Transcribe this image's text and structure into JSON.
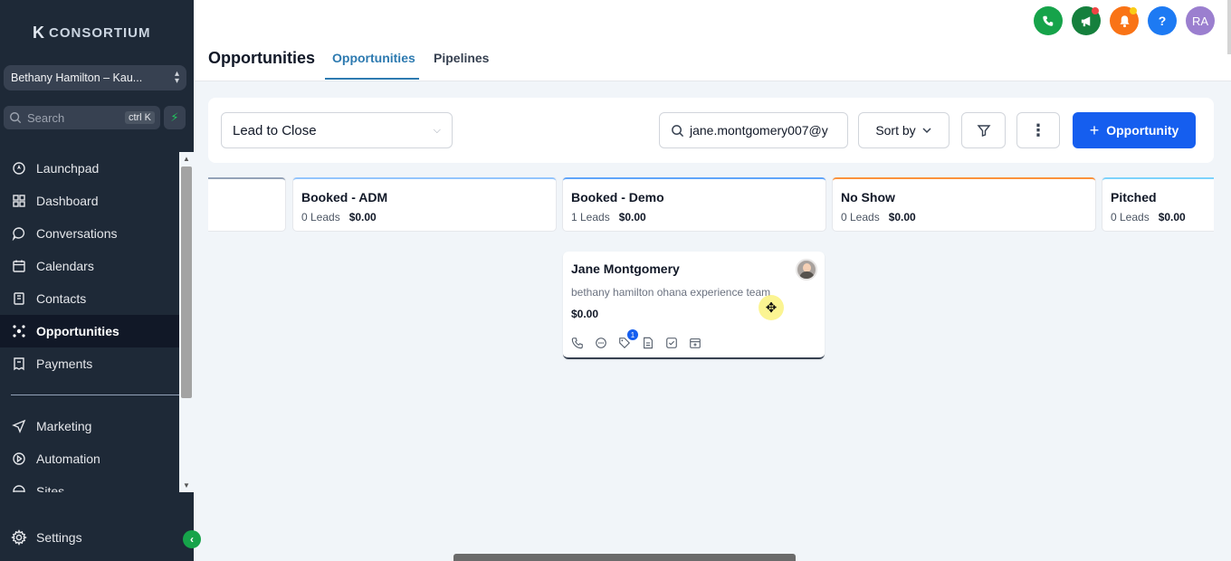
{
  "sidebar": {
    "logo": "CONSORTIUM",
    "account": "Bethany Hamilton – Kau...",
    "search_placeholder": "Search",
    "search_shortcut": "ctrl K",
    "items": [
      {
        "label": "Launchpad",
        "icon": "rocket-icon"
      },
      {
        "label": "Dashboard",
        "icon": "grid-icon"
      },
      {
        "label": "Conversations",
        "icon": "chat-icon"
      },
      {
        "label": "Calendars",
        "icon": "calendar-icon"
      },
      {
        "label": "Contacts",
        "icon": "contacts-icon"
      },
      {
        "label": "Opportunities",
        "icon": "opportunities-icon",
        "active": true
      },
      {
        "label": "Payments",
        "icon": "receipt-icon"
      },
      {
        "label": "Marketing",
        "icon": "send-icon"
      },
      {
        "label": "Automation",
        "icon": "automation-icon"
      },
      {
        "label": "Sites",
        "icon": "globe-icon"
      }
    ],
    "settings": "Settings"
  },
  "header": {
    "title": "Opportunities",
    "tabs": [
      {
        "label": "Opportunities",
        "active": true
      },
      {
        "label": "Pipelines",
        "active": false
      }
    ],
    "avatar_initials": "RA",
    "colors": {
      "phone": "#16a34a",
      "announce": "#15803d",
      "bell": "#f97316",
      "help": "#1d7af3",
      "avatar": "#9b7fcf"
    }
  },
  "toolbar": {
    "pipeline": "Lead to Close",
    "search_value": "jane.montgomery007@y",
    "sort_label": "Sort by",
    "add_label": "Opportunity"
  },
  "board": {
    "stages": [
      {
        "name": "",
        "leads": "",
        "amount": "",
        "color": "#94a3b8"
      },
      {
        "name": "Booked - ADM",
        "leads": "0 Leads",
        "amount": "$0.00",
        "color": "#93c5fd"
      },
      {
        "name": "Booked - Demo",
        "leads": "1 Leads",
        "amount": "$0.00",
        "color": "#60a5fa"
      },
      {
        "name": "No Show",
        "leads": "0 Leads",
        "amount": "$0.00",
        "color": "#fb923c"
      },
      {
        "name": "Pitched",
        "leads": "0 Leads",
        "amount": "$0.00",
        "color": "#7dd3fc"
      }
    ],
    "card": {
      "name": "Jane Montgomery",
      "source": "bethany hamilton ohana experience team",
      "amount": "$0.00",
      "badge": "1"
    }
  }
}
